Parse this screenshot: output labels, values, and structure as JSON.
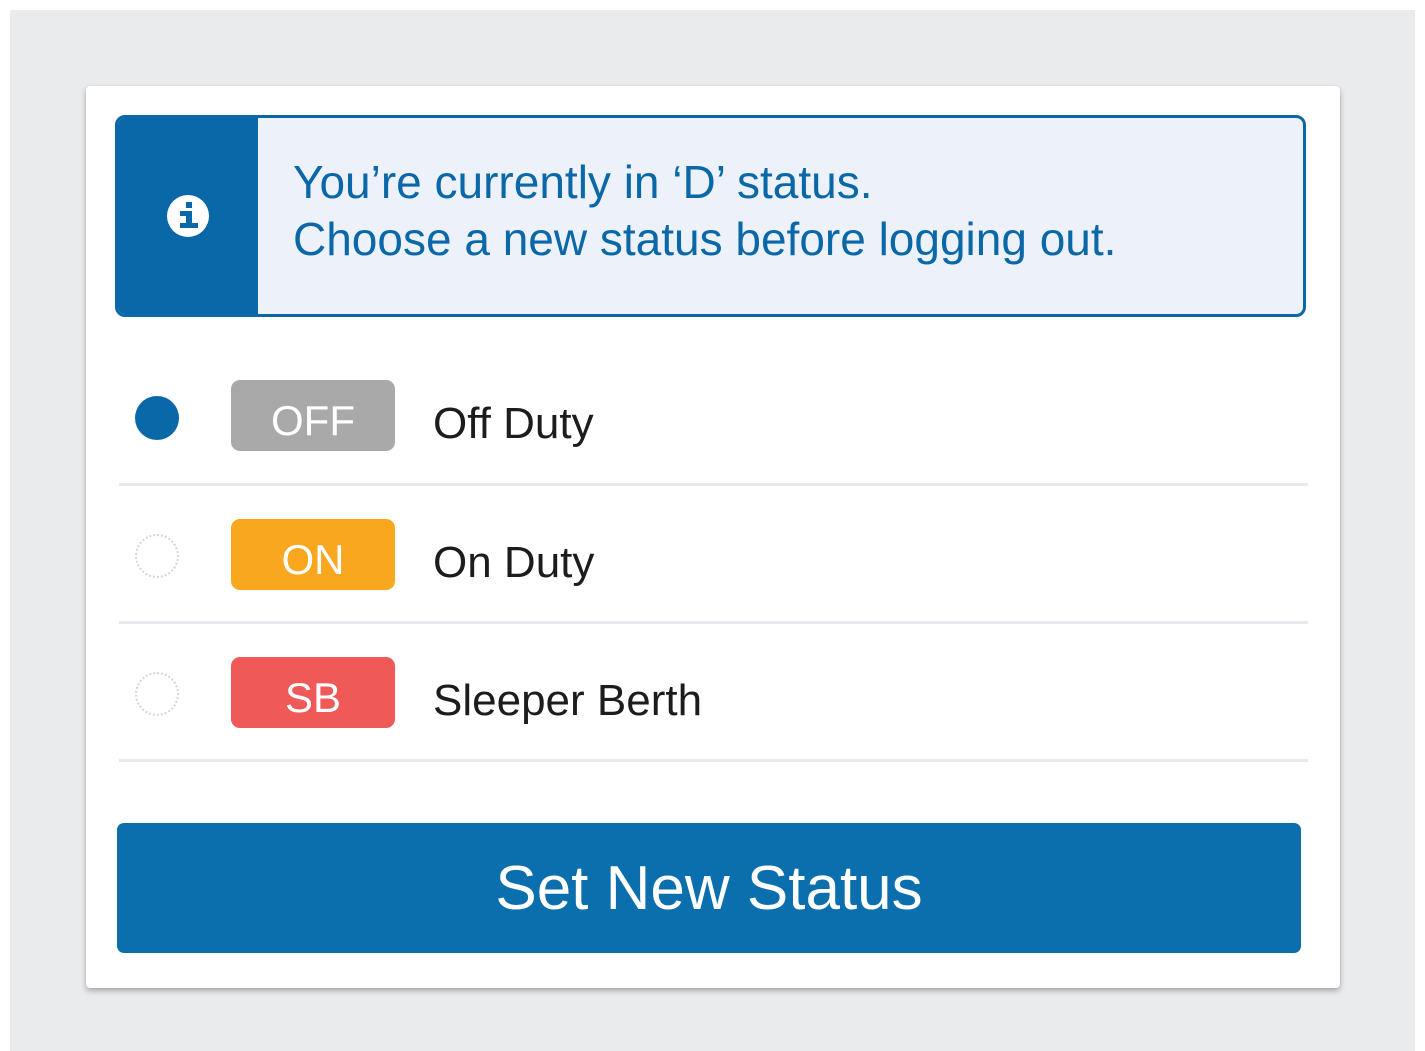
{
  "notice": {
    "icon": "info-icon",
    "line1": "You’re currently in ‘D’ status.",
    "line2": "Choose a new status before logging out.",
    "accent_color": "#0b68a8",
    "background_color": "#ecf1fa"
  },
  "statuses": [
    {
      "code": "OFF",
      "label": "Off Duty",
      "selected": true,
      "badge_color": "#a9a9a9"
    },
    {
      "code": "ON",
      "label": "On Duty",
      "selected": false,
      "badge_color": "#f8a71f"
    },
    {
      "code": "SB",
      "label": "Sleeper Berth",
      "selected": false,
      "badge_color": "#ef5a58"
    }
  ],
  "button": {
    "label": "Set New Status",
    "color": "#0b6fad"
  }
}
